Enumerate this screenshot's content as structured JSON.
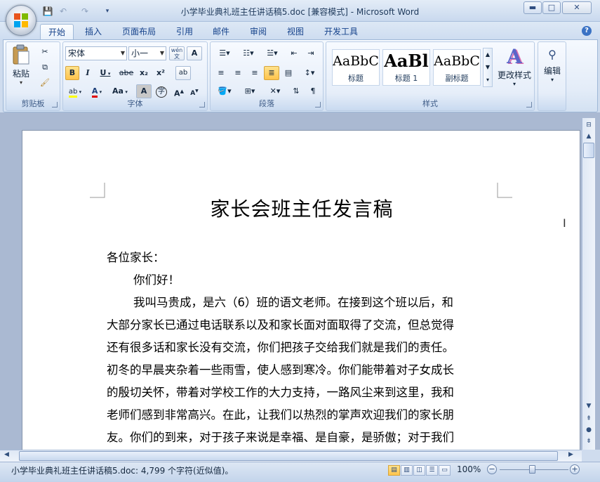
{
  "window": {
    "title": "小学毕业典礼班主任讲话稿5.doc [兼容模式] - Microsoft Word",
    "minimize": "▬",
    "maximize": "□",
    "close": "✕"
  },
  "tabs": [
    "开始",
    "插入",
    "页面布局",
    "引用",
    "邮件",
    "审阅",
    "视图",
    "开发工具"
  ],
  "help_label": "?",
  "clipboard": {
    "paste_label": "粘贴",
    "group_label": "剪贴板"
  },
  "font": {
    "font_name": "宋体",
    "font_size": "小一",
    "wen_label": "wén",
    "bold": "B",
    "italic": "I",
    "underline": "U",
    "strike": "abe",
    "subscript": "x₂",
    "superscript": "x²",
    "font_color_label": "A",
    "case_label": "Aa",
    "grow_label": "A",
    "shrink_label": "A",
    "char_shade": "A",
    "enclose": "字",
    "group_label": "字体"
  },
  "paragraph": {
    "group_label": "段落"
  },
  "styles": {
    "items": [
      {
        "sample": "AaBbC",
        "name": "标题"
      },
      {
        "sample": "AaBl",
        "name": "标题 1"
      },
      {
        "sample": "AaBbC",
        "name": "副标题"
      }
    ],
    "change_label": "更改样式",
    "group_label": "样式"
  },
  "editing": {
    "label": "编辑"
  },
  "document": {
    "heading": "家长会班主任发言稿",
    "paragraphs": [
      "各位家长：",
      "你们好！",
      "我叫马贵成，是六（6）班的语文老师。在接到这个班以后，和",
      "大部分家长已通过电话联系以及和家长面对面取得了交流，但总觉得",
      "还有很多话和家长没有交流，你们把孩子交给我们就是我们的责任。",
      "初冬的早晨夹杂着一些雨雪，使人感到寒冷。你们能带着对子女成长",
      "的殷切关怀，带着对学校工作的大力支持，一路风尘来到这里，我和",
      "老师们感到非常高兴。在此，让我们以热烈的掌声欢迎我们的家长朋",
      "友。你们的到来，对于孩子来说是幸福、是自豪，是骄傲；对于我们"
    ]
  },
  "status": {
    "text": "小学毕业典礼班主任讲话稿5.doc: 4,799 个字符(近似值)。",
    "zoom": "100%"
  }
}
